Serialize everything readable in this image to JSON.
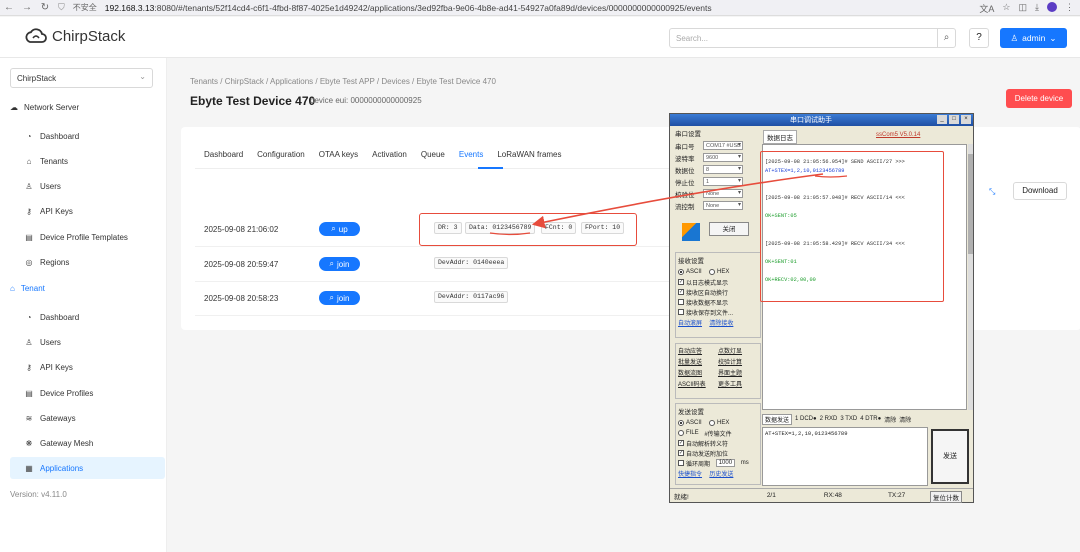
{
  "browser": {
    "security_label": "不安全",
    "url_host": "192.168.3.13",
    "url_rest": ":8080/#/tenants/52f14cd4-c6f1-4fbd-8f87-4025e1d49242/applications/3ed92fba-9e06-4b8e-ad41-54927a0fa89d/devices/0000000000000925/events"
  },
  "header": {
    "logo_text": "ChirpStack",
    "search_placeholder": "Search...",
    "help_label": "?",
    "user_label": "admin"
  },
  "sidebar": {
    "tenant_select": "ChirpStack",
    "network_server_label": "Network Server",
    "network_items": [
      {
        "label": "Dashboard",
        "icon": "dashboard-icon"
      },
      {
        "label": "Tenants",
        "icon": "home-icon"
      },
      {
        "label": "Users",
        "icon": "user-icon"
      },
      {
        "label": "API Keys",
        "icon": "key-icon"
      },
      {
        "label": "Device Profile Templates",
        "icon": "template-icon"
      },
      {
        "label": "Regions",
        "icon": "compass-icon"
      }
    ],
    "tenant_label": "Tenant",
    "tenant_items": [
      {
        "label": "Dashboard",
        "icon": "dashboard-icon"
      },
      {
        "label": "Users",
        "icon": "user-icon"
      },
      {
        "label": "API Keys",
        "icon": "key-icon"
      },
      {
        "label": "Device Profiles",
        "icon": "profile-icon"
      },
      {
        "label": "Gateways",
        "icon": "wifi-icon"
      },
      {
        "label": "Gateway Mesh",
        "icon": "mesh-icon"
      },
      {
        "label": "Applications",
        "icon": "apps-icon"
      }
    ],
    "version": "Version: v4.11.0"
  },
  "main": {
    "breadcrumb": "Tenants / ChirpStack / Applications / Ebyte Test APP / Devices / Ebyte Test Device 470",
    "title": "Ebyte Test Device 470",
    "dev_eui": "device eui: 0000000000000925",
    "delete_label": "Delete device",
    "tabs": [
      "Dashboard",
      "Configuration",
      "OTAA keys",
      "Activation",
      "Queue",
      "Events",
      "LoRaWAN frames"
    ],
    "active_tab": "Events",
    "download_label": "Download",
    "events": [
      {
        "time": "2025-09-08 21:06:02",
        "type": "up",
        "fields": [
          "DR: 3",
          "Data: 0123456789",
          "FCnt: 0",
          "FPort: 10"
        ]
      },
      {
        "time": "2025-09-08 20:59:47",
        "type": "join",
        "fields": [
          "DevAddr: 0140eeea"
        ]
      },
      {
        "time": "2025-09-08 20:58:23",
        "type": "join",
        "fields": [
          "DevAddr: 0117ac96"
        ]
      }
    ]
  },
  "serial": {
    "title": "串口调试助手",
    "port_settings_label": "串口设置",
    "fields": [
      {
        "label": "串口号",
        "value": "COM17 #USB"
      },
      {
        "label": "波特率",
        "value": "9600"
      },
      {
        "label": "数据位",
        "value": "8"
      },
      {
        "label": "停止位",
        "value": "1"
      },
      {
        "label": "校验位",
        "value": "None"
      },
      {
        "label": "流控制",
        "value": "None"
      }
    ],
    "close_label": "关闭",
    "recv_settings_label": "接收设置",
    "recv_ascii": "ASCII",
    "recv_hex": "HEX",
    "recv_checks": [
      "以日志模式显示",
      "接收区自动换行",
      "接收数据不显示",
      "接收保存到文件..."
    ],
    "auto_scroll": "自动滚屏",
    "clear_recv": "清除接收",
    "tools": [
      "自动应答",
      "点数灯显",
      "批量发送",
      "校验计算",
      "数据流图",
      "界面主题",
      "ASCII码表",
      "更多工具"
    ],
    "send_settings_label": "发送设置",
    "send_ascii": "ASCII",
    "send_hex": "HEX",
    "send_file": "FILE",
    "send_file_label": "#传输文件",
    "send_checks": [
      "自动解析转义符",
      "自动发送附加位",
      "循环周期"
    ],
    "cycle_value": "1000",
    "cycle_unit": "ms",
    "send_links": [
      "快捷指令",
      "历史发送"
    ],
    "log_tab": "数据日志",
    "version": "ssCom5 V5.0.14",
    "log": [
      {
        "text": "[2025-09-08 21:05:56.954]# SEND ASCII/27 >>>",
        "style": "normal"
      },
      {
        "text": "AT+STEX=1,2,10,0123456789",
        "style": "blue"
      },
      {
        "text": "[2025-09-08 21:05:57.048]# RECV ASCII/14 <<<",
        "style": "normal"
      },
      {
        "text": "OK+SENT:05",
        "style": "green"
      },
      {
        "text": "[2025-09-08 21:05:58.429]# RECV ASCII/34 <<<",
        "style": "normal"
      },
      {
        "text": "OK+SENT:01",
        "style": "green"
      },
      {
        "text": "OK+RECV:02,00,00",
        "style": "green"
      }
    ],
    "send_tab": "数据发送",
    "send_bar": [
      "1 DCD●",
      "2 RXD",
      "3 TXD",
      "4 DTR●",
      "清除",
      "清除"
    ],
    "send_text": "AT+STEX=1,2,10,0123456789",
    "send_button": "发送",
    "status": {
      "ready": "就绪!",
      "page": "2/1",
      "rx": "RX:48",
      "tx": "TX:27",
      "reset": "复位计数"
    }
  }
}
